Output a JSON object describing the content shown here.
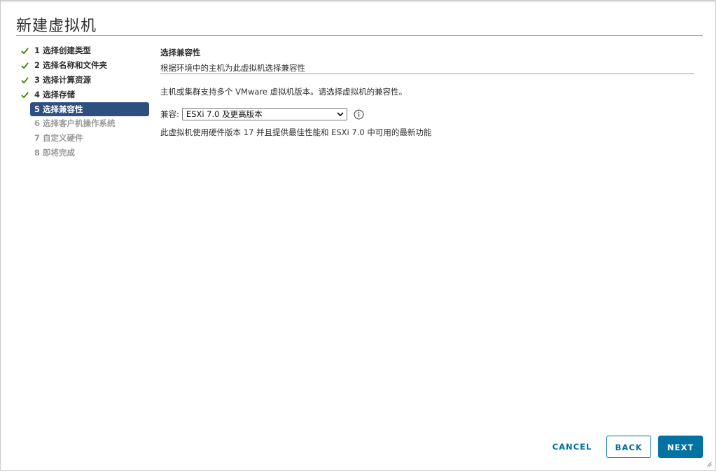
{
  "dialog": {
    "title": "新建虚拟机"
  },
  "steps": [
    {
      "label": "1 选择创建类型",
      "state": "done"
    },
    {
      "label": "2 选择名称和文件夹",
      "state": "done"
    },
    {
      "label": "3 选择计算资源",
      "state": "done"
    },
    {
      "label": "4 选择存储",
      "state": "done"
    },
    {
      "label": "5 选择兼容性",
      "state": "active"
    },
    {
      "label": "6 选择客户机操作系统",
      "state": "pending"
    },
    {
      "label": "7 自定义硬件",
      "state": "pending"
    },
    {
      "label": "8 即将完成",
      "state": "pending"
    }
  ],
  "content": {
    "section_title": "选择兼容性",
    "section_subtitle": "根据环境中的主机为此虚拟机选择兼容性",
    "description": "主机或集群支持多个 VMware 虚拟机版本。请选择虚拟机的兼容性。",
    "compat_label": "兼容:",
    "compat_selected": "ESXi 7.0 及更高版本",
    "hint": "此虚拟机使用硬件版本 17 并且提供最佳性能和 ESXi 7.0 中可用的最新功能"
  },
  "footer": {
    "cancel_label": "CANCEL",
    "back_label": "BACK",
    "next_label": "NEXT"
  },
  "colors": {
    "accent": "#0072a3",
    "active_step_bg": "#2d5081",
    "check_green": "#3c8500",
    "pending_text": "#9a9a9a"
  },
  "icons": {
    "step_done": "check-icon",
    "info": "info-icon",
    "dropdown": "chevron-down-icon"
  }
}
